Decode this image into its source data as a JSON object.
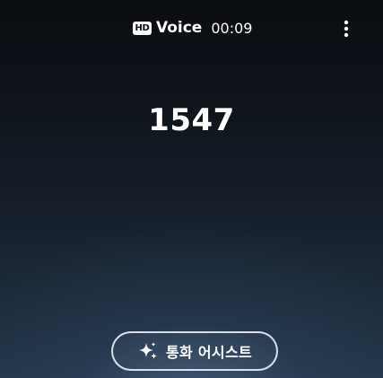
{
  "status": {
    "hd_badge": "HD",
    "call_type": "Voice",
    "timer": "00:09",
    "more_icon": "more-vertical-icon"
  },
  "caller": {
    "number": "1547"
  },
  "assist": {
    "label": "통화 어시스트",
    "icon": "sparkle-icon"
  },
  "colors": {
    "background_top": "#0b0d11",
    "background_bottom": "#223447",
    "text": "#ffffff",
    "button_border": "#e8eef6"
  }
}
